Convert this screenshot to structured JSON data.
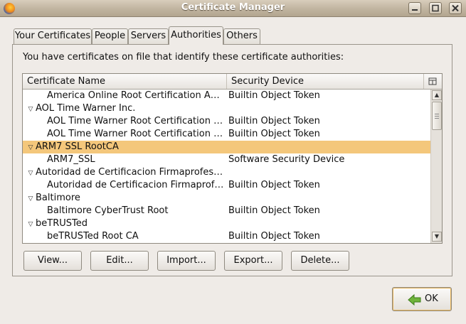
{
  "window": {
    "title": "Certificate Manager"
  },
  "tabs": [
    {
      "label": "Your Certificates"
    },
    {
      "label": "People"
    },
    {
      "label": "Servers"
    },
    {
      "label": "Authorities"
    },
    {
      "label": "Others"
    }
  ],
  "active_tab": "Authorities",
  "description": "You have certificates on file that identify these certificate authorities:",
  "tree": {
    "columns": [
      "Certificate Name",
      "Security Device"
    ],
    "rows": [
      {
        "level": 1,
        "name": "America Online Root Certification Aut…",
        "device": "Builtin Object Token"
      },
      {
        "level": 0,
        "name": "AOL Time Warner Inc.",
        "device": ""
      },
      {
        "level": 1,
        "name": "AOL Time Warner Root Certification A…",
        "device": "Builtin Object Token"
      },
      {
        "level": 1,
        "name": "AOL Time Warner Root Certification A…",
        "device": "Builtin Object Token"
      },
      {
        "level": 0,
        "name": "ARM7 SSL RootCA",
        "device": "",
        "selected": true
      },
      {
        "level": 1,
        "name": "ARM7_SSL",
        "device": "Software Security Device"
      },
      {
        "level": 0,
        "name": "Autoridad de Certificacion Firmaprofesio…",
        "device": ""
      },
      {
        "level": 1,
        "name": "Autoridad de Certificacion Firmaprofe…",
        "device": "Builtin Object Token"
      },
      {
        "level": 0,
        "name": "Baltimore",
        "device": ""
      },
      {
        "level": 1,
        "name": "Baltimore CyberTrust Root",
        "device": "Builtin Object Token"
      },
      {
        "level": 0,
        "name": "beTRUSTed",
        "device": ""
      },
      {
        "level": 1,
        "name": "beTRUSTed Root CA",
        "device": "Builtin Object Token"
      }
    ]
  },
  "buttons": {
    "view": "View...",
    "edit": "Edit...",
    "import": "Import...",
    "export": "Export...",
    "delete": "Delete...",
    "ok": "OK"
  },
  "colors": {
    "selection": "#f4c77b",
    "window_bg": "#efebe7"
  }
}
